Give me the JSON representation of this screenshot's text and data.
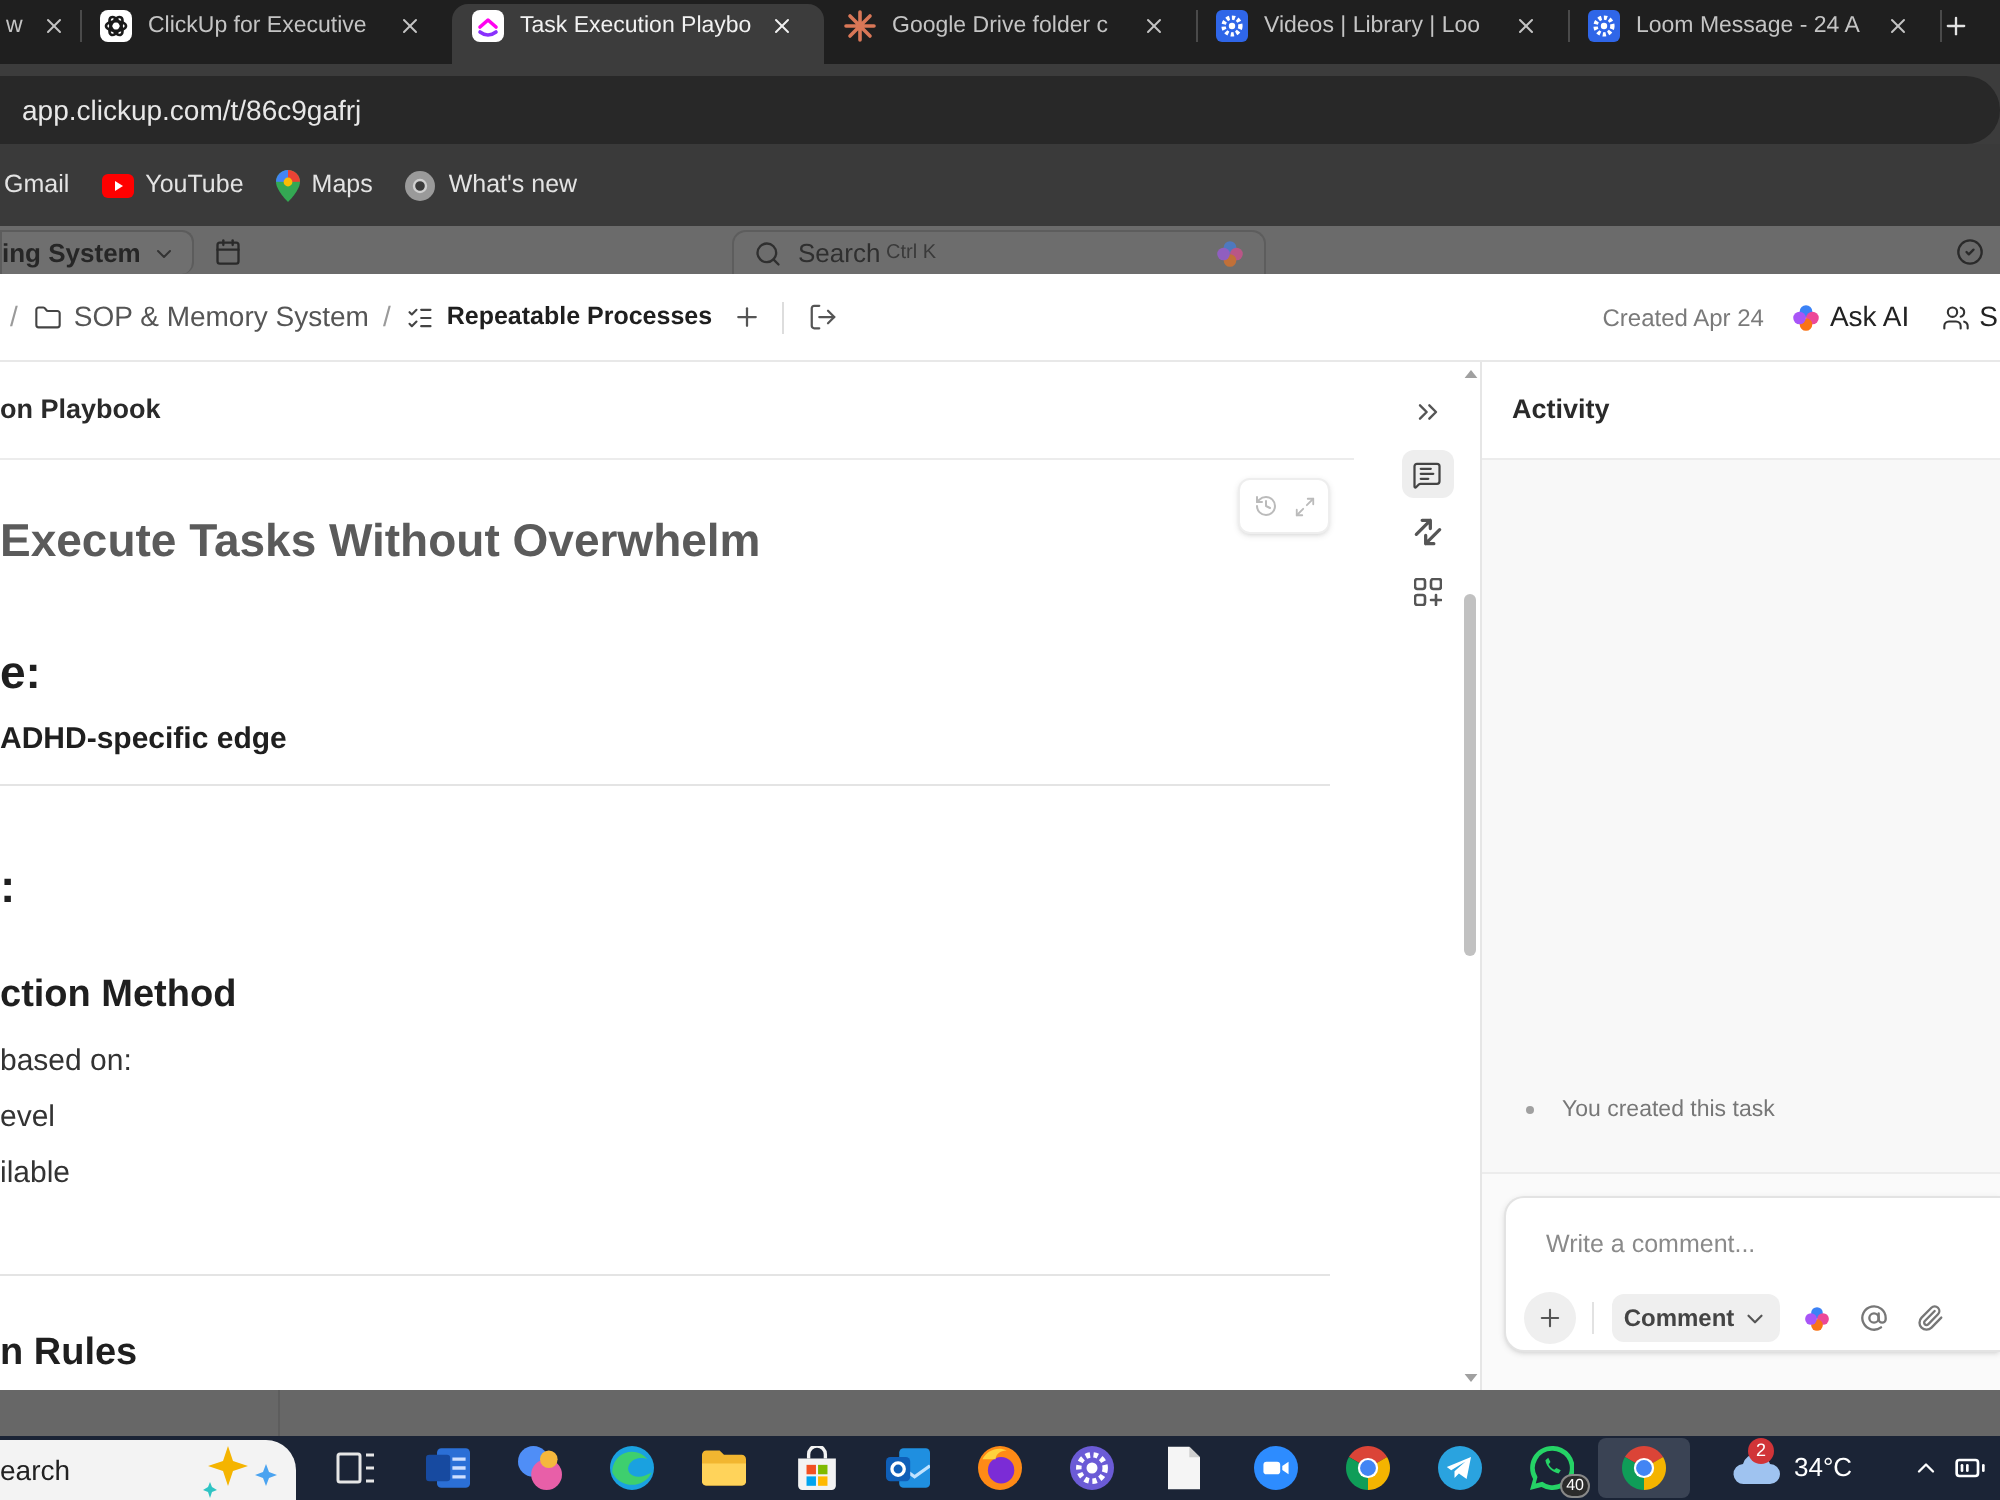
{
  "browser": {
    "tabs": [
      {
        "title": "w",
        "selected": false
      },
      {
        "title": "ClickUp for Executive",
        "selected": false
      },
      {
        "title": "Task Execution Playbo",
        "selected": true
      },
      {
        "title": "Google Drive folder c",
        "selected": false
      },
      {
        "title": "Videos | Library | Loo",
        "selected": false
      },
      {
        "title": "Loom Message - 24 A",
        "selected": false
      }
    ],
    "address": "app.clickup.com/t/86c9gafrj",
    "bookmarks": [
      {
        "label": "Gmail"
      },
      {
        "label": "YouTube"
      },
      {
        "label": "Maps"
      },
      {
        "label": "What's new"
      }
    ]
  },
  "app_header": {
    "workspace": "ing System",
    "search": {
      "placeholder": "Search",
      "shortcut": "Ctrl K"
    }
  },
  "task": {
    "breadcrumb": {
      "separator": "/",
      "items": [
        {
          "label": "SOP & Memory System",
          "current": false
        },
        {
          "label": "Repeatable Processes",
          "current": true
        }
      ]
    },
    "created": "Created Apr 24",
    "ask_ai": "Ask AI",
    "share": "S",
    "doc_title": "on Playbook",
    "blocks": [
      {
        "kind": "title",
        "text": "Execute Tasks Without Overwhelm"
      },
      {
        "kind": "h2",
        "text": "e:"
      },
      {
        "kind": "bold",
        "text": "ADHD-specific edge"
      },
      {
        "kind": "divider"
      },
      {
        "kind": "h2",
        "text": ":"
      },
      {
        "kind": "h3",
        "text": "ction Method"
      },
      {
        "kind": "para",
        "text": "based on:"
      },
      {
        "kind": "para",
        "text": "evel"
      },
      {
        "kind": "para",
        "text": "ilable"
      },
      {
        "kind": "divider"
      },
      {
        "kind": "h3",
        "text": "n Rules"
      }
    ],
    "side_rail": [
      {
        "selected": true
      },
      {
        "selected": false
      },
      {
        "selected": false
      }
    ]
  },
  "activity": {
    "title": "Activity",
    "entries": [
      "You created this task"
    ],
    "composer": {
      "placeholder": "Write a comment...",
      "mode": "Comment"
    }
  },
  "taskbar": {
    "search": {
      "placeholder": "earch"
    },
    "apps": [
      {
        "selected": false
      },
      {
        "selected": false
      },
      {
        "selected": false
      },
      {
        "selected": false
      },
      {
        "selected": false
      },
      {
        "selected": false
      },
      {
        "selected": false
      },
      {
        "selected": false
      },
      {
        "selected": false
      },
      {
        "selected": false
      },
      {
        "selected": false
      },
      {
        "selected": false
      },
      {
        "selected": false
      },
      {
        "selected": false,
        "badge": "40"
      },
      {
        "selected": true
      }
    ],
    "weather": {
      "badge": "2",
      "temperature": "34°C"
    }
  }
}
